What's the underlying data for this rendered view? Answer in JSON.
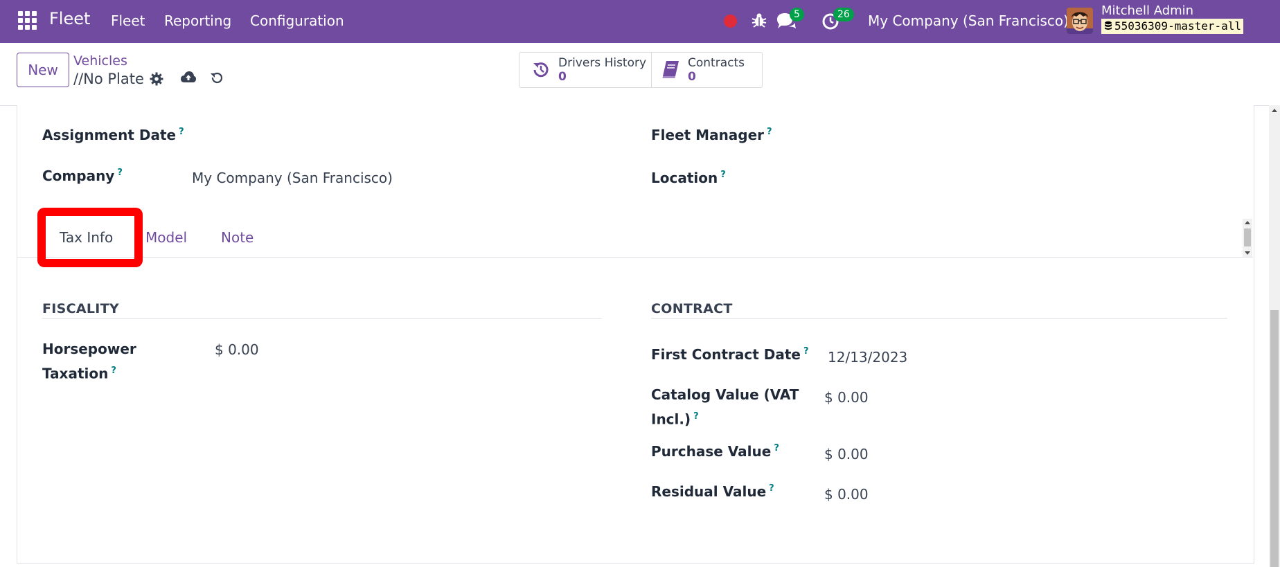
{
  "navbar": {
    "brand": "Fleet",
    "menus": [
      "Fleet",
      "Reporting",
      "Configuration"
    ],
    "messages_count": "5",
    "activities_count": "26",
    "company": "My Company (San Francisco)",
    "user_name": "Mitchell Admin",
    "database": "55036309-master-all"
  },
  "control_panel": {
    "new_label": "New",
    "breadcrumb_parent": "Vehicles",
    "breadcrumb_current": "//No Plate",
    "smart_buttons": [
      {
        "label": "Drivers History",
        "value": "0"
      },
      {
        "label": "Contracts",
        "value": "0"
      }
    ]
  },
  "form": {
    "assignment_date_label": "Assignment Date",
    "assignment_date_value": "",
    "fleet_manager_label": "Fleet Manager",
    "fleet_manager_value": "",
    "company_label": "Company",
    "company_value": "My Company (San Francisco)",
    "location_label": "Location",
    "location_value": "",
    "help_mark": "?"
  },
  "tabs": [
    {
      "label": "Tax Info",
      "active": true
    },
    {
      "label": "Model",
      "active": false
    },
    {
      "label": "Note",
      "active": false
    }
  ],
  "fiscality": {
    "title": "FISCALITY",
    "horsepower_taxation_label_line1": "Horsepower",
    "horsepower_taxation_label_line2": "Taxation",
    "horsepower_taxation_value": "$ 0.00"
  },
  "contract": {
    "title": "CONTRACT",
    "first_contract_date_label": "First Contract Date",
    "first_contract_date_value": "12/13/2023",
    "catalog_value_label_line1": "Catalog Value (VAT",
    "catalog_value_label_line2": "Incl.)",
    "catalog_value_value": "$ 0.00",
    "purchase_value_label": "Purchase Value",
    "purchase_value_value": "$ 0.00",
    "residual_value_label": "Residual Value",
    "residual_value_value": "$ 0.00"
  },
  "colors": {
    "brand_purple": "#714B9F",
    "badge_green": "#00a04a",
    "record_red": "#e02b3b",
    "highlight_red": "#ff0000",
    "help_teal": "#017e84"
  }
}
